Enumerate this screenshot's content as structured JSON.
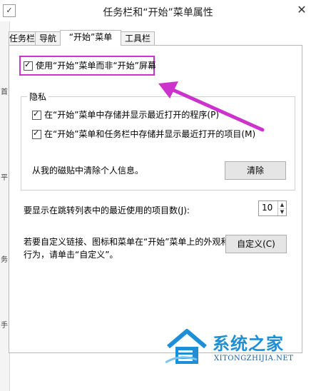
{
  "window": {
    "title": "任务栏和“开始”菜单属性",
    "close_symbol": "✕",
    "icon": "taskbar-properties-icon"
  },
  "left_strip": {
    "fragments": [
      "首",
      "平",
      "务",
      "手"
    ]
  },
  "tabs": [
    {
      "label": "任务栏",
      "active": false
    },
    {
      "label": "导航",
      "active": false
    },
    {
      "label": "“开始”菜单",
      "active": true
    },
    {
      "label": "工具栏",
      "active": false
    }
  ],
  "start_menu_tab": {
    "use_start_menu_checkbox": {
      "label": "使用“开始”菜单而非“开始”屏幕",
      "checked": true
    },
    "privacy": {
      "title": "隐私",
      "store_programs": {
        "label": "在“开始”菜单中存储并显示最近打开的程序(P)",
        "checked": true
      },
      "store_items": {
        "label": "在“开始”菜单和任务栏中存储并显示最近打开的项目(M)",
        "checked": true
      },
      "clear_text": "从我的磁贴中清除个人信息。",
      "clear_button": "清除"
    },
    "jump_list": {
      "label": "要显示在跳转列表中的最近使用的项目数(J):",
      "value": "10"
    },
    "customize": {
      "text_line1": "若要自定义链接、图标和菜单在“开始”菜单上的外观和",
      "text_line2": "行为，请单击“自定义”。",
      "button": "自定义(C)"
    }
  },
  "annotation": {
    "color": "#cc33cc"
  },
  "watermark": {
    "brand": "系统之家",
    "url": "XITONGZHIJIA.NET",
    "color": "#1d8fd6"
  }
}
